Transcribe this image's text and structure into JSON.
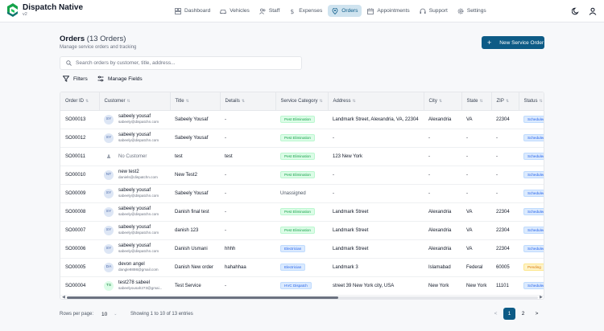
{
  "app": {
    "name": "Dispatch Native",
    "version": "v2"
  },
  "nav": [
    {
      "label": "Dashboard",
      "icon": "dashboard-icon",
      "active": false
    },
    {
      "label": "Vehicles",
      "icon": "car-icon",
      "active": false
    },
    {
      "label": "Staff",
      "icon": "users-icon",
      "active": false
    },
    {
      "label": "Expenses",
      "icon": "dollar-icon",
      "active": false
    },
    {
      "label": "Orders",
      "icon": "map-pin-icon",
      "active": true
    },
    {
      "label": "Appointments",
      "icon": "calendar-icon",
      "active": false
    },
    {
      "label": "Support",
      "icon": "headset-icon",
      "active": false
    },
    {
      "label": "Settings",
      "icon": "gear-icon",
      "active": false
    }
  ],
  "header": {
    "title": "Orders",
    "count": "(13 Orders)",
    "subtitle": "Manage service orders and tracking",
    "new_button": "New Service Order"
  },
  "search": {
    "placeholder": "Search orders by customer, title, address..."
  },
  "toolbar": {
    "filters": "Filters",
    "manage_fields": "Manage Fields"
  },
  "table": {
    "columns": [
      "Order ID",
      "Customer",
      "Title",
      "Details",
      "Service Category",
      "Address",
      "City",
      "State",
      "ZIP",
      "Status"
    ],
    "rows": [
      {
        "id": "SO00013",
        "initials": "SY",
        "name": "sabeely yousaf",
        "email": "sabeely@dispatchn.com",
        "title": "Sabeely Yousaf",
        "details": "-",
        "category": "Pest Elimination",
        "category_style": "green",
        "address": "Landmark Street, Alexandria, VA, 22304",
        "city": "Alexandria",
        "state": "VA",
        "zip": "22304",
        "status": "Scheduled",
        "status_style": "blue"
      },
      {
        "id": "SO00012",
        "initials": "SY",
        "name": "sabeely yousaf",
        "email": "sabeely@dispatchn.com",
        "title": "Sabeely Yousaf",
        "details": "-",
        "category": "Pest Elimination",
        "category_style": "green",
        "address": "-",
        "city": "-",
        "state": "-",
        "zip": "-",
        "status": "Scheduled",
        "status_style": "blue"
      },
      {
        "id": "SO00011",
        "initials": "",
        "name": "No Customer",
        "email": "",
        "title": "test",
        "details": "test",
        "category": "Pest Elimination",
        "category_style": "green",
        "address": "123 New York",
        "city": "-",
        "state": "-",
        "zip": "-",
        "status": "Scheduled",
        "status_style": "blue"
      },
      {
        "id": "SO00010",
        "initials": "NT",
        "name": "new test2",
        "email": "daniels@dispatchn.com",
        "title": "New Test2",
        "details": "-",
        "category": "Pest Elimination",
        "category_style": "green",
        "address": "-",
        "city": "-",
        "state": "-",
        "zip": "-",
        "status": "Scheduled",
        "status_style": "blue"
      },
      {
        "id": "SO00009",
        "initials": "SY",
        "name": "sabeely yousaf",
        "email": "sabeely@dispatchn.com",
        "title": "Sabeely Yousaf",
        "details": "-",
        "category": "Unassigned",
        "category_style": "plain",
        "address": "-",
        "city": "-",
        "state": "-",
        "zip": "-",
        "status": "Scheduled",
        "status_style": "blue"
      },
      {
        "id": "SO00008",
        "initials": "SY",
        "name": "sabeely yousaf",
        "email": "sabeely@dispatchn.com",
        "title": "Danish final test",
        "details": "-",
        "category": "Pest Elimination",
        "category_style": "green",
        "address": "Landmark Street",
        "city": "Alexandria",
        "state": "VA",
        "zip": "22304",
        "status": "Scheduled",
        "status_style": "blue"
      },
      {
        "id": "SO00007",
        "initials": "SY",
        "name": "sabeely yousaf",
        "email": "sabeely@dispatchn.com",
        "title": "danish 123",
        "details": "-",
        "category": "Pest Elimination",
        "category_style": "green",
        "address": "Landmark Street",
        "city": "Alexandria",
        "state": "VA",
        "zip": "22304",
        "status": "Scheduled",
        "status_style": "blue"
      },
      {
        "id": "SO00006",
        "initials": "SY",
        "name": "sabeely yousaf",
        "email": "sabeely@dispatchn.com",
        "title": "Danish Usmani",
        "details": "hhhh",
        "category": "Electrician",
        "category_style": "blue",
        "address": "Landmark Street",
        "city": "Alexandria",
        "state": "VA",
        "zip": "22304",
        "status": "Scheduled",
        "status_style": "blue"
      },
      {
        "id": "SO00005",
        "initials": "DA",
        "name": "devon angel",
        "email": "dangle9898@gmail.com",
        "title": "Danish New order",
        "details": "hahahhaa",
        "category": "Electrician",
        "category_style": "blue",
        "address": "Landmark 3",
        "city": "Islamabad",
        "state": "Federal",
        "zip": "60005",
        "status": "Pending",
        "status_style": "orange"
      },
      {
        "id": "SO00004",
        "initials": "TS",
        "name": "test278 sabeel",
        "email": "sabeelyousah273@gmai...",
        "title": "Test Service",
        "details": "-",
        "category": "HVC Dispatch",
        "category_style": "blue",
        "address": "street 39 New York city, USA",
        "city": "New York",
        "state": "New York",
        "zip": "11101",
        "status": "Scheduled",
        "status_style": "blue",
        "avatar_style": "green"
      }
    ]
  },
  "footer": {
    "rows_per_page_label": "Rows per page:",
    "rows_per_page": "10",
    "showing": "Showing 1 to 10 of 13 entries",
    "pages": [
      "1",
      "2"
    ],
    "current_page": "1"
  },
  "colors": {
    "accent": "#0d5b86",
    "active_nav_bg": "#cfe3ef"
  }
}
